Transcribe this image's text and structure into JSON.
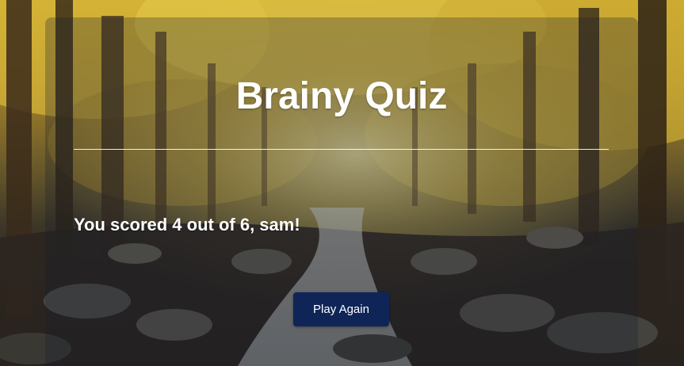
{
  "app": {
    "title": "Brainy Quiz"
  },
  "result": {
    "message": "You scored 4 out of 6, sam!"
  },
  "actions": {
    "play_again_label": "Play Again"
  },
  "theme": {
    "button_color": "#0f2557",
    "text_color": "#ffffff",
    "background_scene": "autumn-forest-stream"
  }
}
